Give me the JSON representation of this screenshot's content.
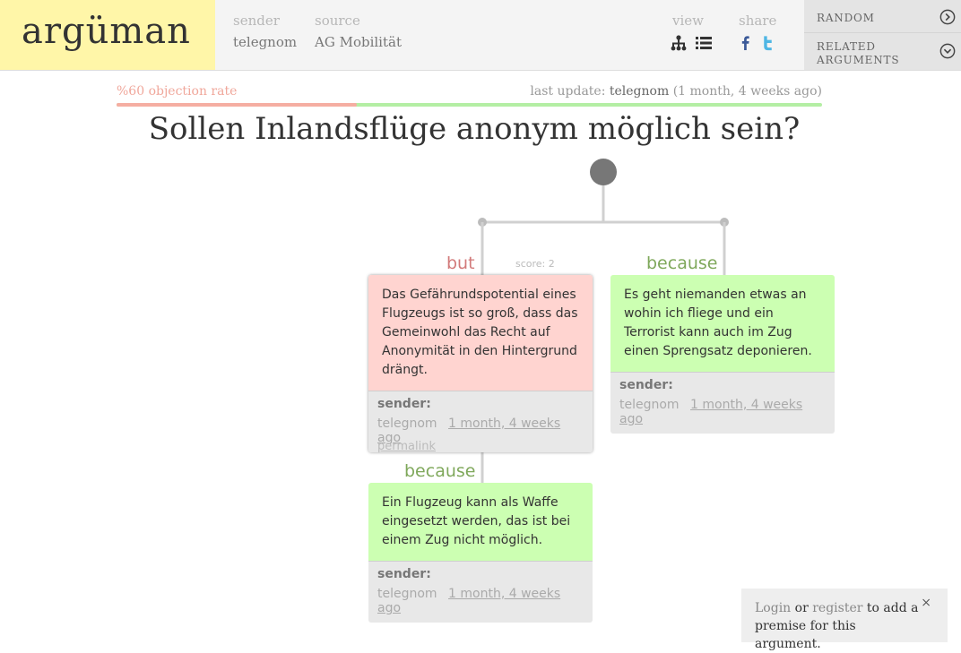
{
  "header": {
    "logo": "argüman",
    "sender_label": "sender",
    "sender_value": "telegnom",
    "source_label": "source",
    "source_value": "AG Mobilität",
    "view_label": "view",
    "share_label": "share",
    "icons": [
      "tree-view-icon",
      "list-view-icon",
      "facebook-icon",
      "twitter-icon"
    ],
    "menu": [
      {
        "label": "RANDOM",
        "icon": "chevron-right-circle-icon"
      },
      {
        "label": "RELATED ARGUMENTS",
        "icon": "chevron-down-circle-icon"
      }
    ]
  },
  "stats": {
    "objection_rate": "%60 objection rate",
    "objection_fraction": 0.34,
    "last_update_label": "last update:",
    "last_update_user": "telegnom",
    "last_update_time": "(1 month, 4 weeks ago)"
  },
  "argument": {
    "title": "Sollen Inlandsflüge anonym möglich sein?"
  },
  "premises": [
    {
      "relation": "but",
      "score": "score: 2",
      "text": "Das Gefährundspotential eines Flugzeugs ist so groß, dass das Gemeinwohl das Recht auf Anonymität in den Hintergrund drängt.",
      "sender_label": "sender:",
      "sender": "telegnom",
      "date": "1 month, 4 weeks ago",
      "permalink": "permalink"
    },
    {
      "relation": "because",
      "text": "Es geht niemanden etwas an wohin ich fliege und ein Terrorist kann auch im Zug einen Sprengsatz deponieren.",
      "sender_label": "sender:",
      "sender": "telegnom",
      "date": "1 month, 4 weeks ago"
    },
    {
      "relation": "because",
      "text": "Ein Flugzeug kann als Waffe eingesetzt werden, das ist bei einem Zug nicht möglich.",
      "sender_label": "sender:",
      "sender": "telegnom",
      "date": "1 month, 4 weeks ago"
    }
  ],
  "login": {
    "login_link": "Login",
    "or": " or ",
    "register_link": "register",
    "rest": " to add a premise for this argument.",
    "close": "×"
  },
  "colors": {
    "logo_bg": "#fff6a8",
    "objection": "#ffd4d0",
    "support": "#ccffb2",
    "but_text": "#d27a7a",
    "because_text": "#7fa85b"
  }
}
